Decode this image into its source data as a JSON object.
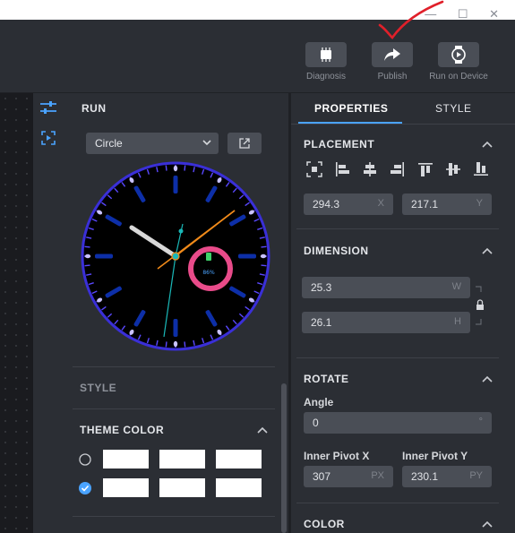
{
  "window": {
    "controls": "— ☐ ✕"
  },
  "toolbar": {
    "diagnosis_label": "Diagnosis",
    "publish_label": "Publish",
    "run_label": "Run on Device"
  },
  "run": {
    "title": "RUN",
    "shape_select": "Circle",
    "style_label": "STYLE",
    "theme_title": "THEME COLOR"
  },
  "watch": {
    "battery_percent": "86%"
  },
  "tabs": {
    "properties": "PROPERTIES",
    "style": "STYLE"
  },
  "placement": {
    "title": "PLACEMENT",
    "x_value": "294.3",
    "x_suffix": "X",
    "y_value": "217.1",
    "y_suffix": "Y"
  },
  "dimension": {
    "title": "DIMENSION",
    "w_value": "25.3",
    "w_suffix": "W",
    "h_value": "26.1",
    "h_suffix": "H"
  },
  "rotate": {
    "title": "ROTATE",
    "angle_label": "Angle",
    "angle_value": "0",
    "angle_suffix": "°",
    "pivot_x_label": "Inner Pivot X",
    "pivot_y_label": "Inner Pivot Y",
    "pivot_x_value": "307",
    "pivot_x_suffix": "PX",
    "pivot_y_value": "230.1",
    "pivot_y_suffix": "PY"
  },
  "color": {
    "title": "COLOR"
  },
  "colors": {
    "accent": "#4aa3ff",
    "annotation": "#e0202a",
    "ring": "#e94b8a"
  }
}
